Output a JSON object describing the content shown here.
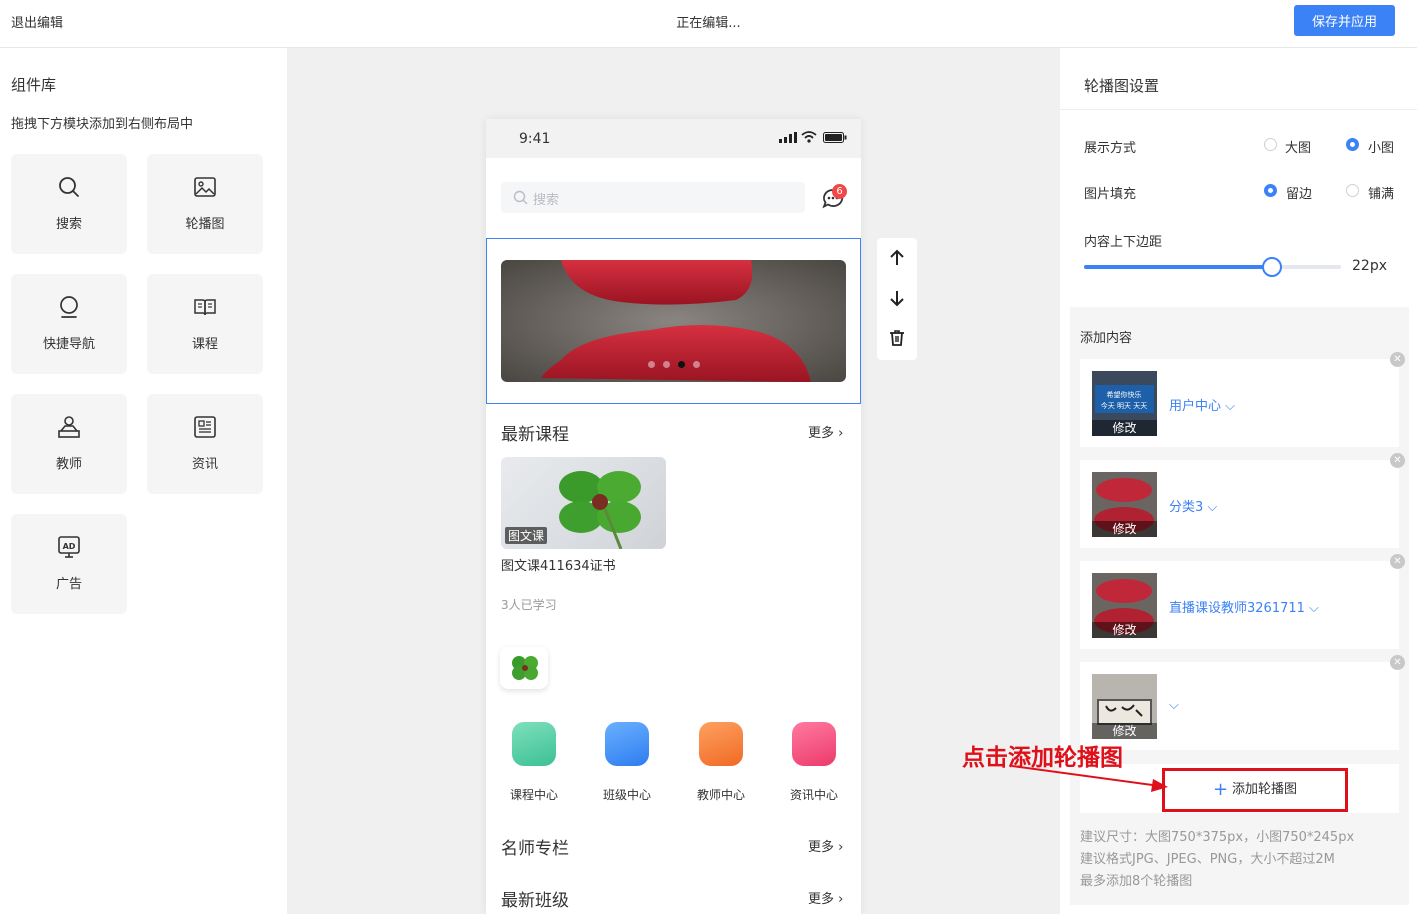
{
  "header": {
    "exit_label": "退出编辑",
    "status_text": "正在编辑...",
    "save_label": "保存并应用"
  },
  "library": {
    "title": "组件库",
    "subtitle": "拖拽下方模块添加到右侧布局中",
    "items": [
      {
        "label": "搜索",
        "icon": "search-icon"
      },
      {
        "label": "轮播图",
        "icon": "image-icon"
      },
      {
        "label": "快捷导航",
        "icon": "pin-icon"
      },
      {
        "label": "课程",
        "icon": "book-icon"
      },
      {
        "label": "教师",
        "icon": "teacher-icon"
      },
      {
        "label": "资讯",
        "icon": "news-icon"
      },
      {
        "label": "广告",
        "icon": "ad-icon"
      }
    ]
  },
  "phone": {
    "time": "9:41",
    "search_placeholder": "搜索",
    "message_badge": "6",
    "carousel": {
      "dots": 4,
      "active_dot": 3
    },
    "sections": {
      "latest_courses": {
        "title": "最新课程",
        "more": "更多 ›"
      },
      "famous_teachers": {
        "title": "名师专栏",
        "more": "更多 ›"
      },
      "latest_classes": {
        "title": "最新班级",
        "more": "更多 ›"
      }
    },
    "course": {
      "tag": "图文课",
      "name": "图文课411634证书",
      "learners": "3人已学习"
    },
    "nav": [
      {
        "label": "课程中心",
        "color": "#5ccfa8"
      },
      {
        "label": "班级中心",
        "color": "#4a90f5"
      },
      {
        "label": "教师中心",
        "color": "#f5823a"
      },
      {
        "label": "资讯中心",
        "color": "#f04d7d"
      }
    ]
  },
  "settings": {
    "title": "轮播图设置",
    "display": {
      "label": "展示方式",
      "options": [
        "大图",
        "小图"
      ],
      "selected": "小图"
    },
    "fill": {
      "label": "图片填充",
      "options": [
        "留边",
        "铺满"
      ],
      "selected": "留边"
    },
    "padding": {
      "label": "内容上下边距",
      "value": 22,
      "max": 30,
      "value_text": "22px"
    },
    "content": {
      "title": "添加内容",
      "edit_label": "修改",
      "items": [
        {
          "link": "用户中心 ⌵",
          "image": "sign-image"
        },
        {
          "link": "分类3 ⌵",
          "image": "meat-image"
        },
        {
          "link": "直播课设教师3261711 ⌵",
          "image": "meat-image"
        },
        {
          "link": "⌵",
          "image": "calligraphy-image"
        }
      ],
      "add_label": "添加轮播图",
      "tips": [
        "建议尺寸：大图750*375px，小图750*245px",
        "建议格式JPG、JPEG、PNG，大小不超过2M",
        "最多添加8个轮播图"
      ]
    }
  },
  "annotation": "点击添加轮播图",
  "colors": {
    "accent": "#3b82f6",
    "annotation": "#e0101a"
  }
}
